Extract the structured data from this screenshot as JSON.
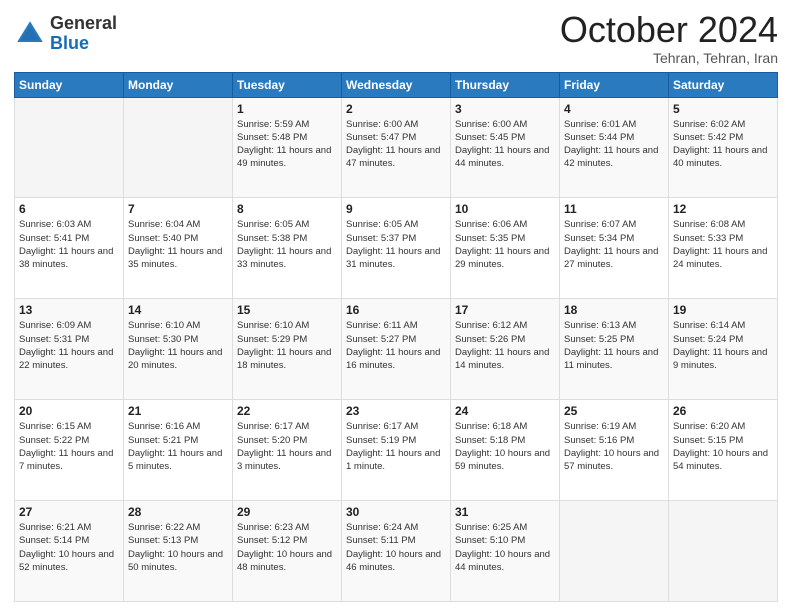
{
  "header": {
    "logo_general": "General",
    "logo_blue": "Blue",
    "month": "October 2024",
    "location": "Tehran, Tehran, Iran"
  },
  "weekdays": [
    "Sunday",
    "Monday",
    "Tuesday",
    "Wednesday",
    "Thursday",
    "Friday",
    "Saturday"
  ],
  "weeks": [
    [
      {
        "day": "",
        "info": ""
      },
      {
        "day": "",
        "info": ""
      },
      {
        "day": "1",
        "info": "Sunrise: 5:59 AM\nSunset: 5:48 PM\nDaylight: 11 hours and 49 minutes."
      },
      {
        "day": "2",
        "info": "Sunrise: 6:00 AM\nSunset: 5:47 PM\nDaylight: 11 hours and 47 minutes."
      },
      {
        "day": "3",
        "info": "Sunrise: 6:00 AM\nSunset: 5:45 PM\nDaylight: 11 hours and 44 minutes."
      },
      {
        "day": "4",
        "info": "Sunrise: 6:01 AM\nSunset: 5:44 PM\nDaylight: 11 hours and 42 minutes."
      },
      {
        "day": "5",
        "info": "Sunrise: 6:02 AM\nSunset: 5:42 PM\nDaylight: 11 hours and 40 minutes."
      }
    ],
    [
      {
        "day": "6",
        "info": "Sunrise: 6:03 AM\nSunset: 5:41 PM\nDaylight: 11 hours and 38 minutes."
      },
      {
        "day": "7",
        "info": "Sunrise: 6:04 AM\nSunset: 5:40 PM\nDaylight: 11 hours and 35 minutes."
      },
      {
        "day": "8",
        "info": "Sunrise: 6:05 AM\nSunset: 5:38 PM\nDaylight: 11 hours and 33 minutes."
      },
      {
        "day": "9",
        "info": "Sunrise: 6:05 AM\nSunset: 5:37 PM\nDaylight: 11 hours and 31 minutes."
      },
      {
        "day": "10",
        "info": "Sunrise: 6:06 AM\nSunset: 5:35 PM\nDaylight: 11 hours and 29 minutes."
      },
      {
        "day": "11",
        "info": "Sunrise: 6:07 AM\nSunset: 5:34 PM\nDaylight: 11 hours and 27 minutes."
      },
      {
        "day": "12",
        "info": "Sunrise: 6:08 AM\nSunset: 5:33 PM\nDaylight: 11 hours and 24 minutes."
      }
    ],
    [
      {
        "day": "13",
        "info": "Sunrise: 6:09 AM\nSunset: 5:31 PM\nDaylight: 11 hours and 22 minutes."
      },
      {
        "day": "14",
        "info": "Sunrise: 6:10 AM\nSunset: 5:30 PM\nDaylight: 11 hours and 20 minutes."
      },
      {
        "day": "15",
        "info": "Sunrise: 6:10 AM\nSunset: 5:29 PM\nDaylight: 11 hours and 18 minutes."
      },
      {
        "day": "16",
        "info": "Sunrise: 6:11 AM\nSunset: 5:27 PM\nDaylight: 11 hours and 16 minutes."
      },
      {
        "day": "17",
        "info": "Sunrise: 6:12 AM\nSunset: 5:26 PM\nDaylight: 11 hours and 14 minutes."
      },
      {
        "day": "18",
        "info": "Sunrise: 6:13 AM\nSunset: 5:25 PM\nDaylight: 11 hours and 11 minutes."
      },
      {
        "day": "19",
        "info": "Sunrise: 6:14 AM\nSunset: 5:24 PM\nDaylight: 11 hours and 9 minutes."
      }
    ],
    [
      {
        "day": "20",
        "info": "Sunrise: 6:15 AM\nSunset: 5:22 PM\nDaylight: 11 hours and 7 minutes."
      },
      {
        "day": "21",
        "info": "Sunrise: 6:16 AM\nSunset: 5:21 PM\nDaylight: 11 hours and 5 minutes."
      },
      {
        "day": "22",
        "info": "Sunrise: 6:17 AM\nSunset: 5:20 PM\nDaylight: 11 hours and 3 minutes."
      },
      {
        "day": "23",
        "info": "Sunrise: 6:17 AM\nSunset: 5:19 PM\nDaylight: 11 hours and 1 minute."
      },
      {
        "day": "24",
        "info": "Sunrise: 6:18 AM\nSunset: 5:18 PM\nDaylight: 10 hours and 59 minutes."
      },
      {
        "day": "25",
        "info": "Sunrise: 6:19 AM\nSunset: 5:16 PM\nDaylight: 10 hours and 57 minutes."
      },
      {
        "day": "26",
        "info": "Sunrise: 6:20 AM\nSunset: 5:15 PM\nDaylight: 10 hours and 54 minutes."
      }
    ],
    [
      {
        "day": "27",
        "info": "Sunrise: 6:21 AM\nSunset: 5:14 PM\nDaylight: 10 hours and 52 minutes."
      },
      {
        "day": "28",
        "info": "Sunrise: 6:22 AM\nSunset: 5:13 PM\nDaylight: 10 hours and 50 minutes."
      },
      {
        "day": "29",
        "info": "Sunrise: 6:23 AM\nSunset: 5:12 PM\nDaylight: 10 hours and 48 minutes."
      },
      {
        "day": "30",
        "info": "Sunrise: 6:24 AM\nSunset: 5:11 PM\nDaylight: 10 hours and 46 minutes."
      },
      {
        "day": "31",
        "info": "Sunrise: 6:25 AM\nSunset: 5:10 PM\nDaylight: 10 hours and 44 minutes."
      },
      {
        "day": "",
        "info": ""
      },
      {
        "day": "",
        "info": ""
      }
    ]
  ]
}
